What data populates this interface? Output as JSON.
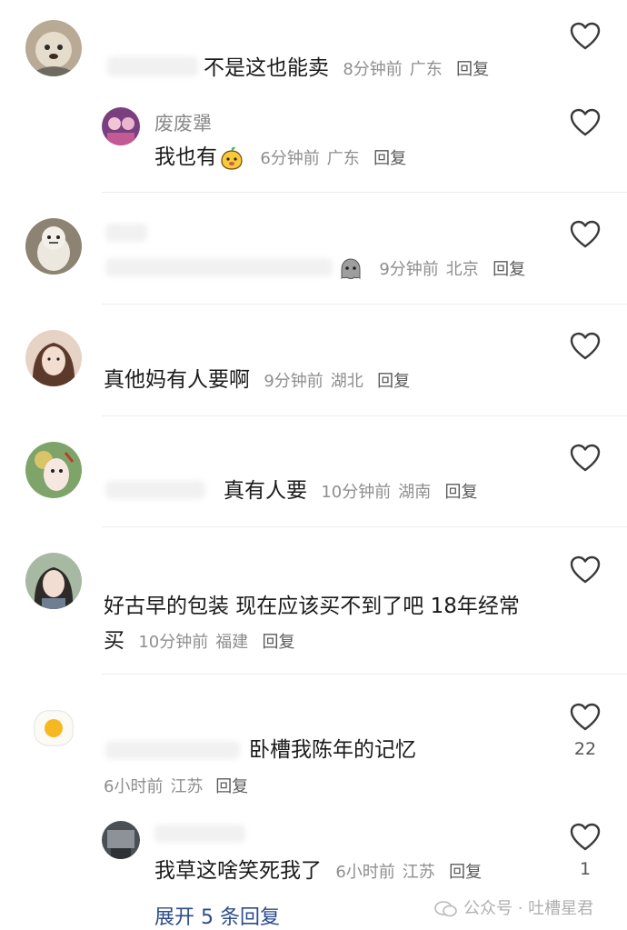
{
  "comments": [
    {
      "text": "不是这也能卖",
      "time": "8分钟前",
      "location": "广东",
      "reply": "回复"
    },
    {
      "username": "废废犟",
      "text": "我也有",
      "time": "6分钟前",
      "location": "广东",
      "reply": "回复"
    },
    {
      "time": "9分钟前",
      "location": "北京",
      "reply": "回复"
    },
    {
      "text": "真他妈有人要啊",
      "time": "9分钟前",
      "location": "湖北",
      "reply": "回复"
    },
    {
      "text": "真有人要",
      "time": "10分钟前",
      "location": "湖南",
      "reply": "回复"
    },
    {
      "text": "好古早的包装 现在应该买不到了吧 18年经常买",
      "time": "10分钟前",
      "location": "福建",
      "reply": "回复"
    },
    {
      "text": "卧槽我陈年的记忆",
      "time": "6小时前",
      "location": "江苏",
      "reply": "回复",
      "likes": "22"
    },
    {
      "text": "我草这啥笑死我了",
      "time": "6小时前",
      "location": "江苏",
      "reply": "回复",
      "likes": "1"
    }
  ],
  "expand_label": "展开 5 条回复",
  "watermark": "公众号 · 吐槽星君",
  "colors": {
    "heart": "#3a3a3a",
    "meta": "#8e8e8e",
    "expand": "#2b4c8c"
  }
}
